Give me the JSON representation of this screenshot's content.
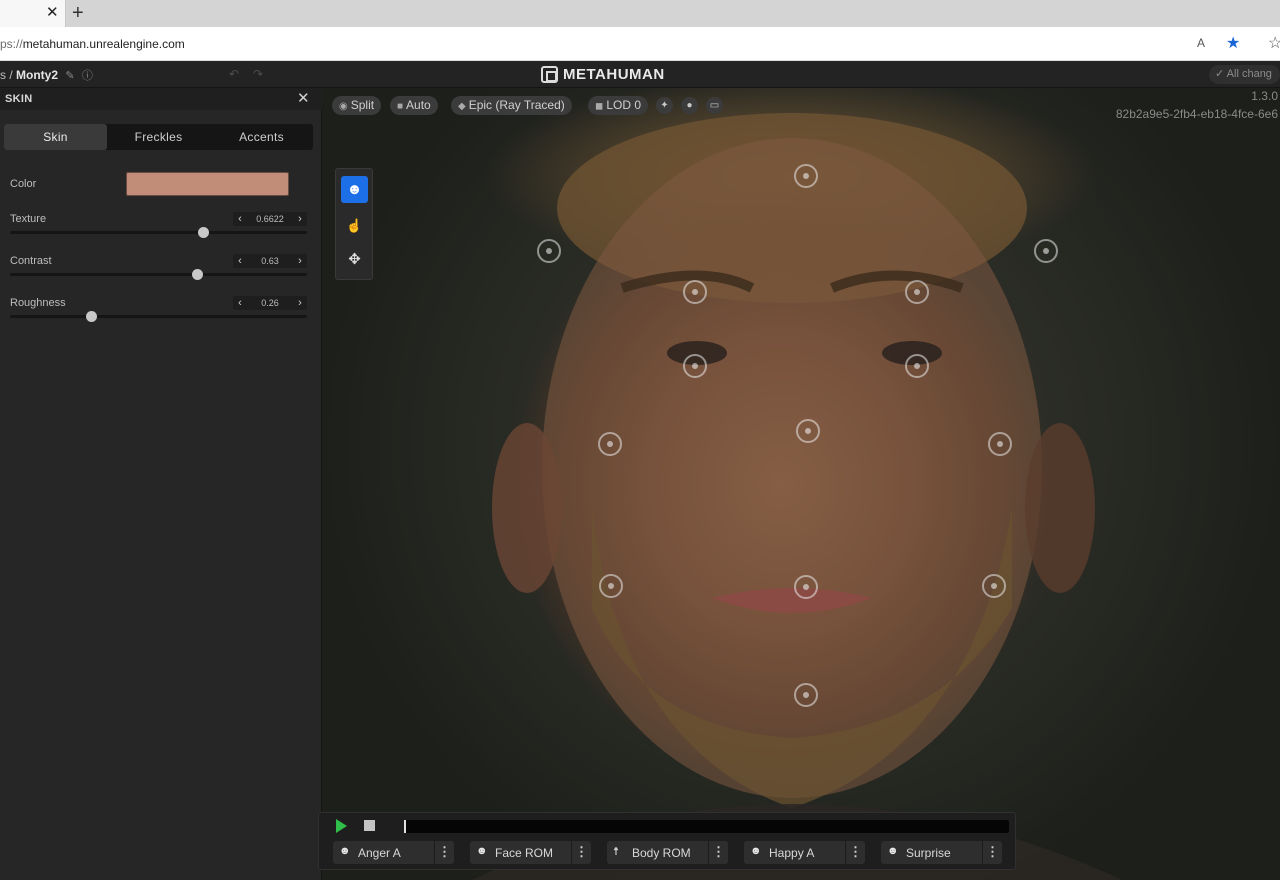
{
  "browser": {
    "tab_close": "✕",
    "new_tab": "+",
    "url_scheme": "ps://",
    "url_rest": "metahuman.unrealengine.com",
    "read_aloud_icon": "A",
    "favorite_icon": "★",
    "favorites_icon": "☆"
  },
  "app": {
    "breadcrumb_prefix": "s /",
    "project_name": "Monty2",
    "logo_text": "METAHUMAN",
    "save_status": "All chang"
  },
  "panel": {
    "title": "SKIN",
    "tabs": [
      {
        "label": "Skin",
        "active": true
      },
      {
        "label": "Freckles",
        "active": false
      },
      {
        "label": "Accents",
        "active": false
      }
    ],
    "color_label": "Color",
    "color_value": "#c18c78",
    "sliders": [
      {
        "label": "Texture",
        "value": "0.6622",
        "fraction": 0.65
      },
      {
        "label": "Contrast",
        "value": "0.63",
        "fraction": 0.628
      },
      {
        "label": "Roughness",
        "value": "0.26",
        "fraction": 0.274
      }
    ]
  },
  "viewport": {
    "pills": [
      "Split",
      "Auto",
      "Epic (Ray Traced)",
      "LOD 0"
    ],
    "version": "1.3.0",
    "build_id": "82b2a9e5-2fb4-eb18-4fce-6e6"
  },
  "timeline": {
    "animations": [
      "Anger A",
      "Face ROM",
      "Body ROM",
      "Happy A",
      "Surprise"
    ]
  }
}
